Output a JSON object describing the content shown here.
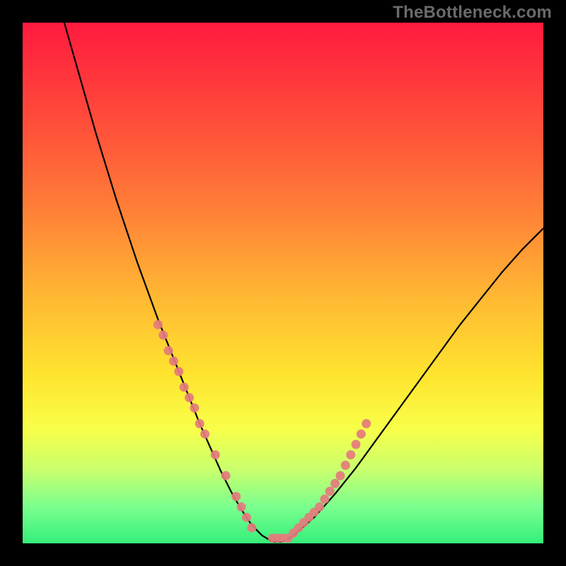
{
  "attribution": "TheBottleneck.com",
  "chart_data": {
    "type": "line",
    "title": "",
    "xlabel": "",
    "ylabel": "",
    "xlim": [
      0,
      100
    ],
    "ylim": [
      0,
      100
    ],
    "grid": false,
    "legend": false,
    "series": [
      {
        "name": "curve",
        "stroke": "#000000",
        "x": [
          8,
          10,
          12,
          14,
          16,
          18,
          20,
          22,
          24,
          26,
          28,
          30,
          32,
          34,
          36,
          38,
          40,
          42,
          44,
          46,
          48,
          50,
          52,
          56,
          60,
          64,
          68,
          72,
          76,
          80,
          84,
          88,
          92,
          96,
          100
        ],
        "y": [
          100,
          93,
          86,
          79,
          72.5,
          66,
          60,
          54,
          48.5,
          43,
          38,
          33,
          28,
          23,
          18.5,
          14,
          10,
          6.5,
          3.5,
          1.5,
          0.3,
          0.3,
          1.5,
          5,
          9.5,
          14.5,
          20,
          25.5,
          31,
          36.5,
          42,
          47,
          52,
          56.5,
          60.5
        ]
      }
    ],
    "markers": [
      {
        "name": "dots-left",
        "stroke": "#e47b7d",
        "x": [
          26,
          27,
          28,
          29,
          30,
          31,
          32,
          33,
          34,
          35,
          37,
          39,
          41,
          42,
          43,
          44
        ],
        "y": [
          42,
          40,
          37,
          35,
          33,
          30,
          28,
          26,
          23,
          21,
          17,
          13,
          9,
          7,
          5,
          3
        ]
      },
      {
        "name": "dots-right",
        "stroke": "#e47b7d",
        "x": [
          48,
          49,
          50,
          51,
          52,
          53,
          54,
          55,
          56,
          57,
          58,
          59,
          60,
          61
        ],
        "y": [
          1,
          1,
          1,
          1,
          2,
          3,
          4,
          5,
          6,
          7,
          8.5,
          10,
          11.5,
          13
        ]
      },
      {
        "name": "dots-right-upper",
        "stroke": "#e47b7d",
        "x": [
          62,
          63,
          64,
          65,
          66
        ],
        "y": [
          15,
          17,
          19,
          21,
          23
        ]
      }
    ],
    "gradient_stops": [
      {
        "offset": 0,
        "color": "#ff1a3f"
      },
      {
        "offset": 18,
        "color": "#ff4a3a"
      },
      {
        "offset": 35,
        "color": "#ff7c37"
      },
      {
        "offset": 52,
        "color": "#ffb633"
      },
      {
        "offset": 68,
        "color": "#ffe52f"
      },
      {
        "offset": 78,
        "color": "#f8ff49"
      },
      {
        "offset": 86,
        "color": "#c8ff6e"
      },
      {
        "offset": 93,
        "color": "#7aff8e"
      },
      {
        "offset": 100,
        "color": "#35ef7a"
      }
    ]
  }
}
